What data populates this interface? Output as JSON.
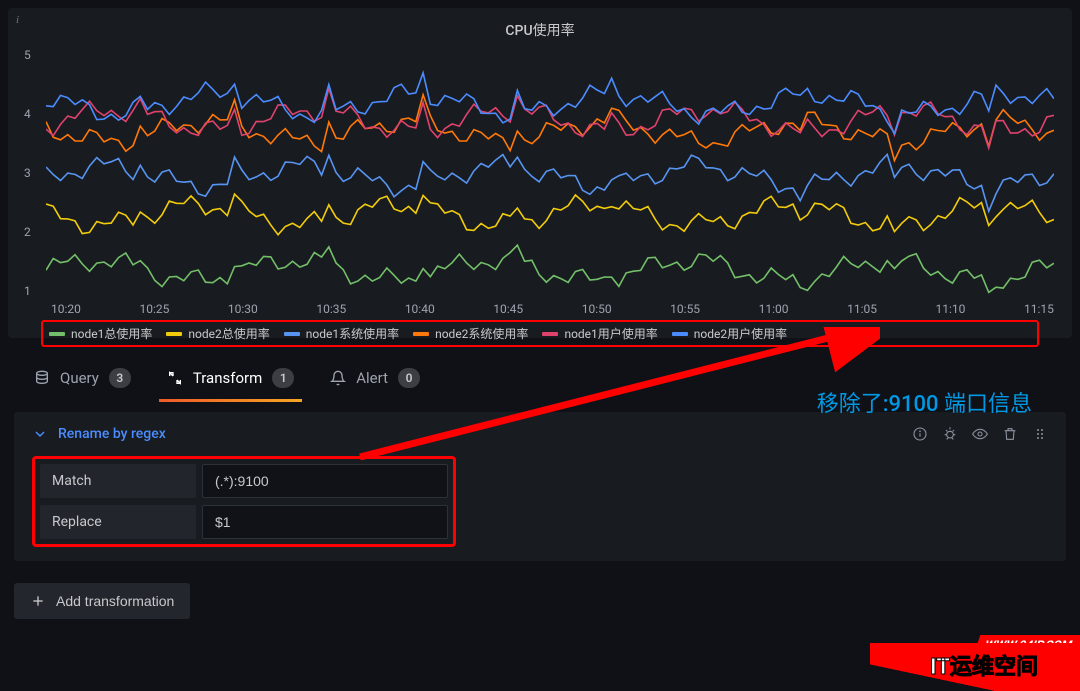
{
  "panel": {
    "title": "CPU使用率"
  },
  "chart_data": {
    "type": "line",
    "xlabel": "",
    "ylabel": "",
    "ylim": [
      0.5,
      5
    ],
    "x_ticks": [
      "10:20",
      "10:25",
      "10:30",
      "10:35",
      "10:40",
      "10:45",
      "10:50",
      "10:55",
      "11:00",
      "11:05",
      "11:10",
      "11:15"
    ],
    "y_ticks": [
      1,
      2,
      3,
      4,
      5
    ],
    "series": [
      {
        "name": "node1总使用率",
        "color": "#73bf69",
        "approx_mean": 1.0
      },
      {
        "name": "node2总使用率",
        "color": "#f2cc0c",
        "approx_mean": 2.0
      },
      {
        "name": "node1系统使用率",
        "color": "#5794f2",
        "approx_mean": 2.7
      },
      {
        "name": "node2系统使用率",
        "color": "#ff780a",
        "approx_mean": 3.5
      },
      {
        "name": "node1用户使用率",
        "color": "#e0426e",
        "approx_mean": 3.7
      },
      {
        "name": "node2用户使用率",
        "color": "#4a8cff",
        "approx_mean": 4.0
      }
    ]
  },
  "tabs": {
    "query": {
      "label": "Query",
      "count": "3"
    },
    "transform": {
      "label": "Transform",
      "count": "1"
    },
    "alert": {
      "label": "Alert",
      "count": "0"
    }
  },
  "transform": {
    "title": "Rename by regex",
    "match_label": "Match",
    "match_value": "(.*):9100",
    "replace_label": "Replace",
    "replace_value": "$1"
  },
  "buttons": {
    "add_transformation": "Add transformation"
  },
  "annotation": {
    "text": "移除了:9100 端口信息"
  },
  "watermark": {
    "url": "WWW.94IP.COM",
    "main": "IT运维空间"
  }
}
